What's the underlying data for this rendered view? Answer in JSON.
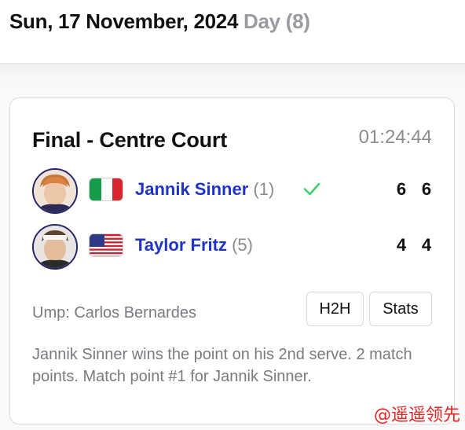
{
  "header": {
    "date": "Sun, 17 November, 2024",
    "day_label": "Day (8)"
  },
  "match": {
    "title": "Final - Centre Court",
    "duration": "01:24:44",
    "players": [
      {
        "name": "Jannik Sinner",
        "seed": "(1)",
        "country_flag": "italy-flag",
        "winner": true,
        "sets": [
          "6",
          "6"
        ]
      },
      {
        "name": "Taylor Fritz",
        "seed": "(5)",
        "country_flag": "usa-flag",
        "winner": false,
        "sets": [
          "4",
          "4"
        ]
      }
    ],
    "umpire": "Ump: Carlos Bernardes",
    "buttons": {
      "h2h": "H2H",
      "stats": "Stats"
    },
    "commentary": "Jannik Sinner wins the point on his 2nd serve. 2 match points. Match point #1 for Jannik Sinner."
  },
  "watermark": "@遥遥领先",
  "colors": {
    "player_name": "#1f33c9",
    "winner_check": "#3fcf6e",
    "muted_text": "#7a7a80"
  }
}
